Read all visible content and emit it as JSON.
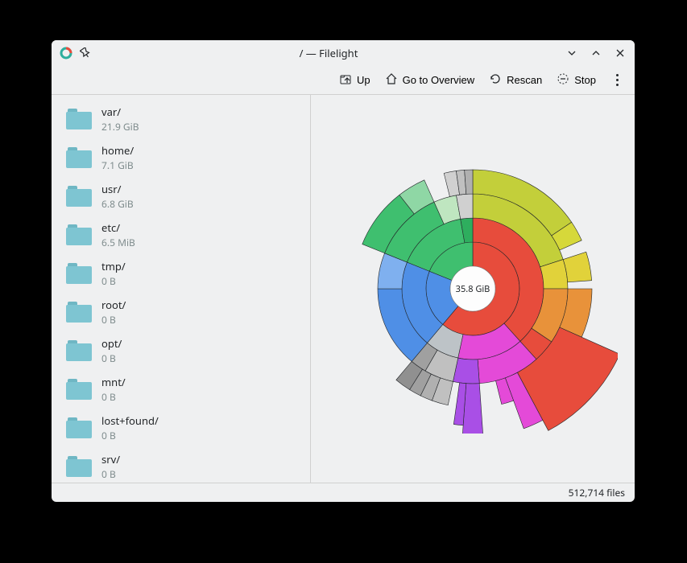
{
  "window": {
    "title": "/ — Filelight",
    "app_icon": "filelight-icon",
    "pin_icon": "pin-icon",
    "minimize_icon": "chevron-down-icon",
    "maximize_icon": "chevron-up-icon",
    "close_icon": "close-icon"
  },
  "toolbar": {
    "up_label": "Up",
    "overview_label": "Go to Overview",
    "rescan_label": "Rescan",
    "stop_label": "Stop"
  },
  "sidebar": {
    "items": [
      {
        "name": "var/",
        "size": "21.9 GiB"
      },
      {
        "name": "home/",
        "size": "7.1 GiB"
      },
      {
        "name": "usr/",
        "size": "6.8 GiB"
      },
      {
        "name": "etc/",
        "size": "6.5 MiB"
      },
      {
        "name": "tmp/",
        "size": "0 B"
      },
      {
        "name": "root/",
        "size": "0 B"
      },
      {
        "name": "opt/",
        "size": "0 B"
      },
      {
        "name": "mnt/",
        "size": "0 B"
      },
      {
        "name": "lost+found/",
        "size": "0 B"
      },
      {
        "name": "srv/",
        "size": "0 B"
      }
    ]
  },
  "chart_data": {
    "type": "sunburst",
    "center_label": "35.8 GiB",
    "total_bytes_label": "35.8 GiB",
    "ring1": [
      {
        "id": "var",
        "name": "var/",
        "value": 21.9,
        "color": "#e74c3c",
        "start": -90,
        "span": 220
      },
      {
        "id": "home",
        "name": "home/",
        "value": 7.1,
        "color": "#4f8fe6",
        "start": 130,
        "span": 72
      },
      {
        "id": "usr",
        "name": "usr/",
        "value": 6.8,
        "color": "#3fbf6f",
        "start": 202,
        "span": 68
      }
    ],
    "ring2": [
      {
        "parent": "var",
        "color": "#e74c3c",
        "start": -90,
        "span": 138
      },
      {
        "parent": "var",
        "color": "#e44ad8",
        "start": 48,
        "span": 54
      },
      {
        "parent": "var",
        "color": "#bdc3c7",
        "start": 102,
        "span": 28
      },
      {
        "parent": "home",
        "color": "#4f8fe6",
        "start": 130,
        "span": 72
      },
      {
        "parent": "usr",
        "color": "#3fbf6f",
        "start": 202,
        "span": 58
      },
      {
        "parent": "usr",
        "color": "#2eae5e",
        "start": 260,
        "span": 10
      }
    ],
    "ring3": [
      {
        "color": "#c3cf3a",
        "start": -90,
        "span": 72
      },
      {
        "color": "#e1d23a",
        "start": -18,
        "span": 18
      },
      {
        "color": "#e8923a",
        "start": 0,
        "span": 34
      },
      {
        "color": "#e74c3c",
        "start": 34,
        "span": 14
      },
      {
        "color": "#e44ad8",
        "start": 48,
        "span": 38
      },
      {
        "color": "#a94fe6",
        "start": 86,
        "span": 16
      },
      {
        "color": "#c0c0c0",
        "start": 102,
        "span": 18
      },
      {
        "color": "#a0a0a0",
        "start": 120,
        "span": 10
      },
      {
        "color": "#4f8fe6",
        "start": 130,
        "span": 50
      },
      {
        "color": "#7fb0ef",
        "start": 180,
        "span": 22
      },
      {
        "color": "#3fbf6f",
        "start": 202,
        "span": 44
      },
      {
        "color": "#bfe6c0",
        "start": 246,
        "span": 14
      },
      {
        "color": "#d0d0d0",
        "start": 260,
        "span": 10
      }
    ],
    "ring4": [
      {
        "color": "#c3cf3a",
        "start": -90,
        "span": 56
      },
      {
        "color": "#d6d83a",
        "start": -34,
        "span": 10
      },
      {
        "color": "#e1d23a",
        "start": -18,
        "span": 14
      },
      {
        "color": "#e8923a",
        "start": 0,
        "span": 24
      },
      {
        "color": "#e74c3c",
        "start": 24,
        "span": 38,
        "extend": 1.35
      },
      {
        "color": "#e44ad8",
        "start": 62,
        "span": 8,
        "extend": 1.25
      },
      {
        "color": "#e44ad8",
        "start": 70,
        "span": 6
      },
      {
        "color": "#a94fe6",
        "start": 86,
        "span": 8,
        "extend": 1.45
      },
      {
        "color": "#a94fe6",
        "start": 94,
        "span": 4,
        "extend": 1.15
      },
      {
        "color": "#c0c0c0",
        "start": 102,
        "span": 8
      },
      {
        "color": "#b0b0b0",
        "start": 110,
        "span": 6
      },
      {
        "color": "#a0a0a0",
        "start": 116,
        "span": 6
      },
      {
        "color": "#909090",
        "start": 122,
        "span": 8
      },
      {
        "color": "#3fbf6f",
        "start": 202,
        "span": 30
      },
      {
        "color": "#8fd7a5",
        "start": 232,
        "span": 14
      },
      {
        "color": "#d0d0d0",
        "start": 256,
        "span": 6
      },
      {
        "color": "#c0c0c0",
        "start": 262,
        "span": 4
      },
      {
        "color": "#b0b0b0",
        "start": 266,
        "span": 4
      }
    ]
  },
  "statusbar": {
    "files_label": "512,714 files"
  }
}
